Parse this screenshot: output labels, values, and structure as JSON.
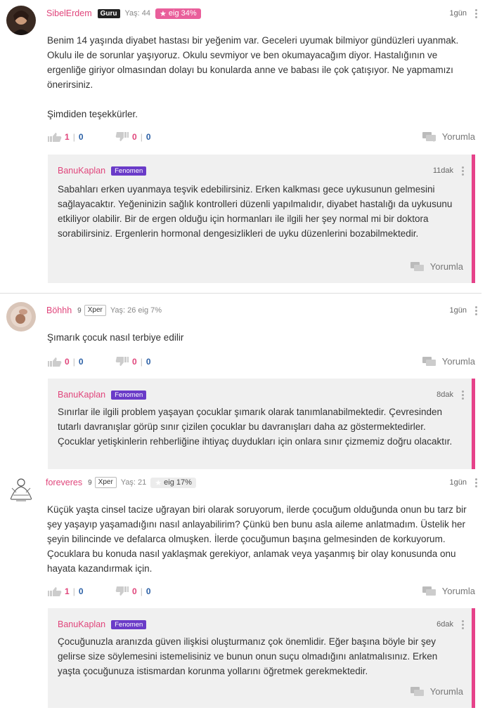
{
  "colors": {
    "accent": "#e0457b",
    "reply_border": "#e6428a",
    "fenomen": "#6a3bc8"
  },
  "posts": [
    {
      "user": "SibelErdem",
      "rank_badge": "Guru",
      "age": "Yaş: 44",
      "eig": "eig 34%",
      "time": "1gün",
      "body": "Benim 14 yaşında diyabet hastası bir yeğenim var. Geceleri uyumak bilmiyor gündüzleri uyanmak. Okulu ile de sorunlar yaşıyoruz. Okulu sevmiyor ve ben okumayacağım diyor. Hastalığının ve ergenliğe giriyor olmasından dolayı bu konularda anne ve babası ile çok çatışıyor. Ne yapmamızı önerirsiniz.\n\nŞimdiden teşekkürler.",
      "up_pos": "1",
      "up_neg": "0",
      "down_pos": "0",
      "down_neg": "0",
      "comment_label": "Yorumla",
      "reply": {
        "user": "BanuKaplan",
        "badge": "Fenomen",
        "time": "11dak",
        "body": "Sabahları erken uyanmaya teşvik edebilirsiniz. Erken kalkması gece uykusunun gelmesini sağlayacaktır. Yeğeninizin sağlık kontrolleri düzenli yapılmalıdır, diyabet hastalığı da uykusunu etkiliyor olabilir. Bir de ergen olduğu için hormanları ile ilgili her şey normal mi bir doktora sorabilirsiniz. Ergenlerin hormonal dengesizlikleri de uyku düzenlerini bozabilmektedir.",
        "comment_label": "Yorumla"
      }
    },
    {
      "user": "Böhhh",
      "xper_level": "9",
      "xper": "Xper",
      "age_eig": "Yaş: 26 eig 7%",
      "time": "1gün",
      "body": "Şımarık çocuk nasıl terbiye edilir",
      "up_pos": "0",
      "up_neg": "0",
      "down_pos": "0",
      "down_neg": "0",
      "comment_label": "Yorumla",
      "reply": {
        "user": "BanuKaplan",
        "badge": "Fenomen",
        "time": "8dak",
        "body": "Sınırlar ile ilgili problem yaşayan çocuklar şımarık olarak tanımlanabilmektedir. Çevresinden tutarlı davranışlar görüp sınır çizilen çocuklar bu davranışları daha az göstermektedirler. Çocuklar yetişkinlerin rehberliğine ihtiyaç duydukları için onlara sınır çizmemiz doğru olacaktır."
      }
    },
    {
      "user": "foreveres",
      "xper_level": "9",
      "xper": "Xper",
      "age": "Yaş: 21",
      "eig": "eig 17%",
      "time": "1gün",
      "body": "Küçük yaşta cinsel tacize uğrayan biri olarak soruyorum, ilerde çocuğum olduğunda onun bu tarz bir şey yaşayıp yaşamadığını nasıl anlayabilirim? Çünkü ben bunu asla aileme anlatmadım. Üstelik her şeyin bilincinde ve defalarca olmuşken. İlerde çocuğumun başına gelmesinden de korkuyorum. Çocuklara bu konuda nasıl yaklaşmak gerekiyor, anlamak veya yaşanmış bir olay konusunda onu hayata kazandırmak için.",
      "up_pos": "1",
      "up_neg": "0",
      "down_pos": "0",
      "down_neg": "0",
      "comment_label": "Yorumla",
      "reply": {
        "user": "BanuKaplan",
        "badge": "Fenomen",
        "time": "6dak",
        "body": "Çocuğunuzla aranızda güven ilişkisi oluşturmanız çok önemlidir. Eğer başına böyle bir şey gelirse size söylemesini istemelisiniz ve bunun onun suçu olmadığını anlatmalısınız. Erken yaşta çocuğunuza istismardan korunma yollarını öğretmek gerekmektedir.",
        "comment_label": "Yorumla"
      }
    }
  ]
}
